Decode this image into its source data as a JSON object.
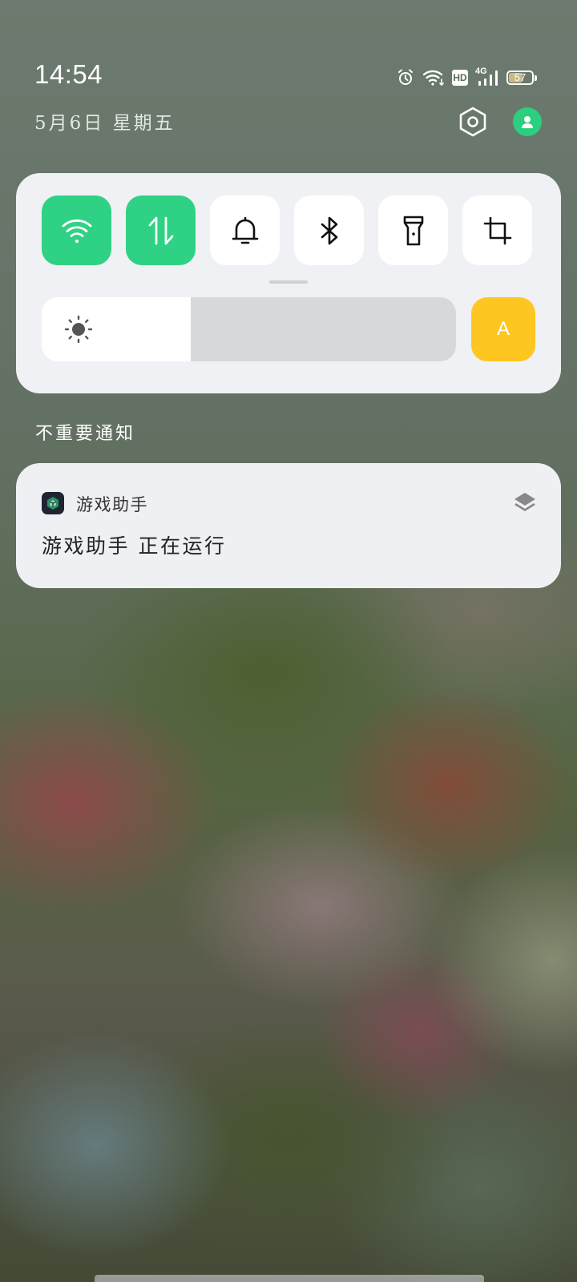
{
  "status_bar": {
    "time": "14:54",
    "hd_label": "HD",
    "network_label": "4G",
    "battery_level": "57",
    "battery_fraction": 0.57,
    "icons": [
      "alarm-icon",
      "wifi-icon",
      "hd-icon",
      "signal-icon",
      "battery-icon"
    ]
  },
  "header": {
    "date": "5月6日 星期五",
    "settings_icon": "settings-icon",
    "account_icon": "account-icon",
    "account_color": "#2ccf7f"
  },
  "quick_settings": {
    "tiles": [
      {
        "icon": "wifi-icon",
        "active": true
      },
      {
        "icon": "mobile-data-icon",
        "active": true
      },
      {
        "icon": "bell-icon",
        "active": false
      },
      {
        "icon": "bluetooth-icon",
        "active": false
      },
      {
        "icon": "flashlight-icon",
        "active": false
      },
      {
        "icon": "screenshot-crop-icon",
        "active": false
      }
    ],
    "active_color": "#2fd184",
    "brightness_level": 0.36,
    "auto_brightness_label": "A",
    "auto_brightness_color": "#fec620"
  },
  "notifications": {
    "section_title": "不重要通知",
    "items": [
      {
        "app_name": "游戏助手",
        "body": "游戏助手 正在运行",
        "app_icon": "game-assistant-icon",
        "stack_icon": "layers-icon"
      }
    ]
  }
}
